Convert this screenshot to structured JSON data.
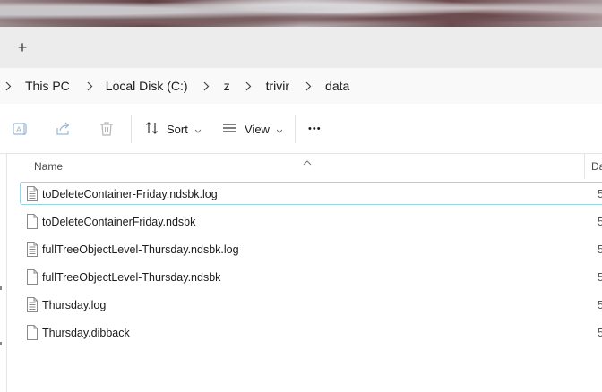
{
  "tabbar": {
    "new_tab_label": "+"
  },
  "breadcrumb": [
    "This PC",
    "Local Disk (C:)",
    "z",
    "trivir",
    "data"
  ],
  "toolbar": {
    "sort_label": "Sort",
    "view_label": "View",
    "more_label": "•••"
  },
  "columns": {
    "name": "Name",
    "date": "Da"
  },
  "files": [
    {
      "name": "toDeleteContainer-Friday.ndsbk.log",
      "date": "5/",
      "icon": "text-file-icon"
    },
    {
      "name": "toDeleteContainerFriday.ndsbk",
      "date": "5/",
      "icon": "blank-file-icon"
    },
    {
      "name": "fullTreeObjectLevel-Thursday.ndsbk.log",
      "date": "5/",
      "icon": "text-file-icon"
    },
    {
      "name": "fullTreeObjectLevel-Thursday.ndsbk",
      "date": "5/",
      "icon": "blank-file-icon"
    },
    {
      "name": "Thursday.log",
      "date": "5/",
      "icon": "text-file-icon"
    },
    {
      "name": "Thursday.dibback",
      "date": "5/",
      "icon": "blank-file-icon"
    }
  ],
  "selected_index": 0
}
